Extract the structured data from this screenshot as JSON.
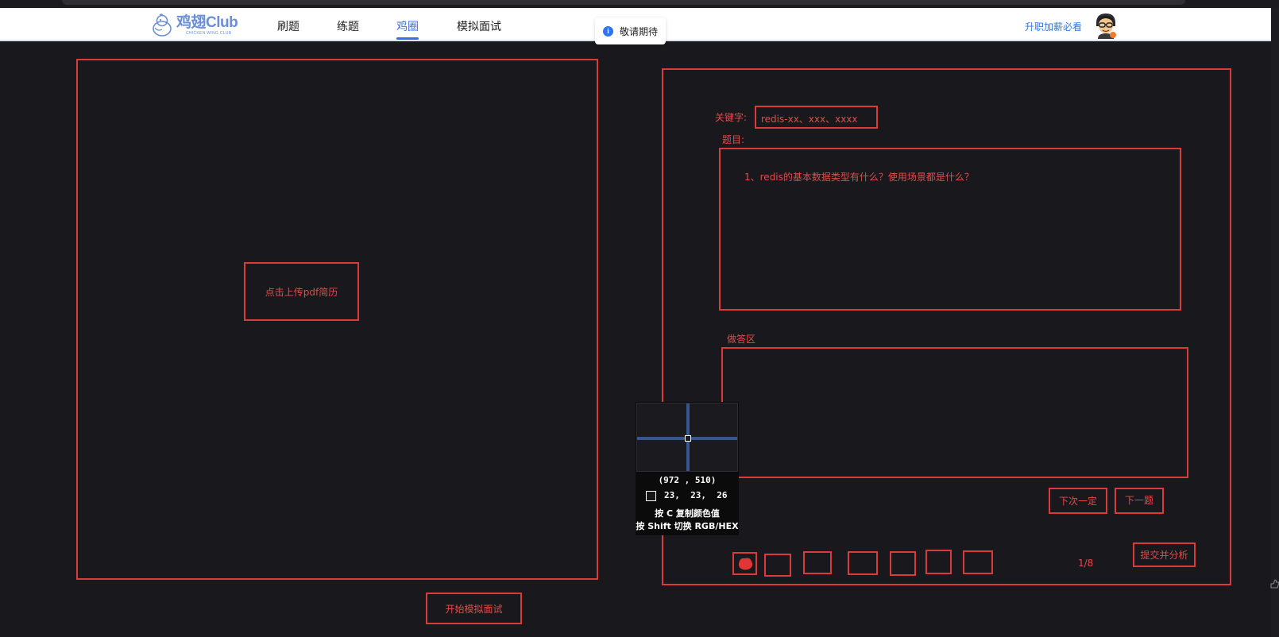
{
  "header": {
    "logo": {
      "text": "鸡翅Club",
      "subtext": "CHICKEN WING CLUB",
      "icon": "chick-logo-icon"
    },
    "nav": [
      {
        "label": "刷题",
        "active": false
      },
      {
        "label": "练题",
        "active": false
      },
      {
        "label": "鸡圈",
        "active": true
      },
      {
        "label": "模拟面试",
        "active": false
      }
    ],
    "promo_link": "升职加薪必看",
    "avatar_icon": "user-avatar-icon"
  },
  "toast": {
    "icon": "info-icon",
    "text": "敬请期待"
  },
  "colors": {
    "accent": "#3a6fe8",
    "outline": "#d93a3a",
    "background": "#19191d",
    "header_bg": "#ffffff"
  },
  "left_panel": {
    "upload_button": "点击上传pdf简历",
    "start_button": "开始模拟面试"
  },
  "right_panel": {
    "keyword_label": "关键字:",
    "keyword_value": "redis-xx、xxx、xxxx",
    "question_label": "题目:",
    "question_text": "1、redis的基本数据类型有什么？使用场景都是什么？",
    "answer_label": "做答区",
    "answer_value": "",
    "next_time_button": "下次一定",
    "next_question_button": "下一题",
    "submit_button": "提交并分析",
    "pager": "1/8"
  },
  "color_picker": {
    "coord": "(972 , 510)",
    "rgb": "23,  23,  26",
    "hint_copy": "按 C 复制颜色值",
    "hint_switch": "按 Shift 切换 RGB/HEX"
  }
}
